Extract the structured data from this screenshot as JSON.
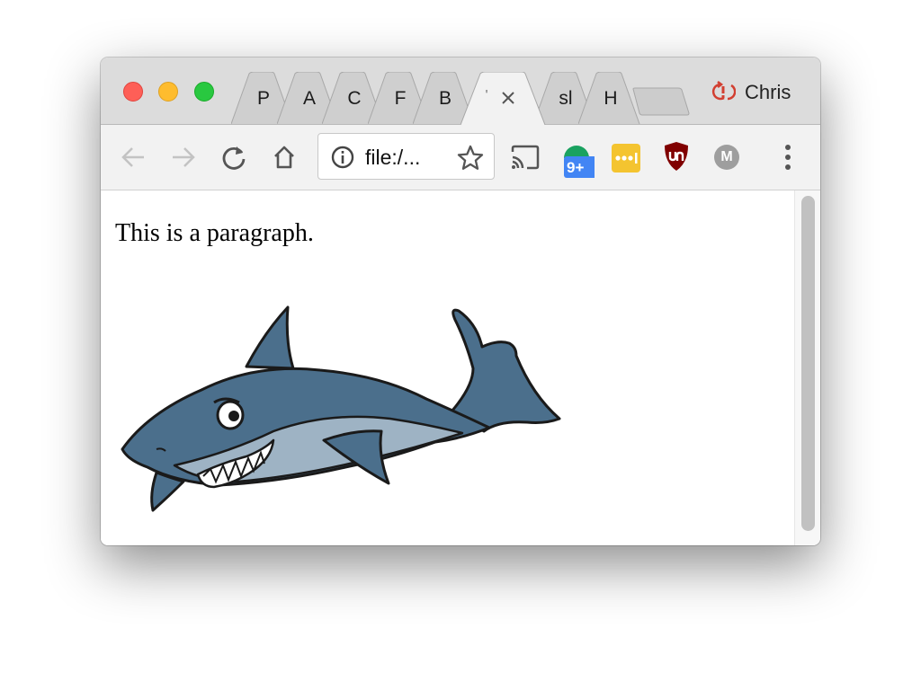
{
  "browser": {
    "tabs": [
      {
        "label": "P",
        "active": false
      },
      {
        "label": "A",
        "active": false
      },
      {
        "label": "C",
        "active": false
      },
      {
        "label": "F",
        "active": false
      },
      {
        "label": "B",
        "active": false
      },
      {
        "label": "'",
        "active": true
      },
      {
        "label": "sl",
        "active": false
      },
      {
        "label": "H",
        "active": false
      }
    ],
    "profile": {
      "name": "Chris",
      "icon": "sync-error-icon",
      "accent": "#d23f31"
    },
    "omnibox": {
      "text": "file:/...",
      "icon": "info-icon"
    },
    "extensions": [
      {
        "name": "calendar-extension",
        "badge": "9+",
        "color": "#1aa260",
        "badge_color": "#4285f4"
      },
      {
        "name": "lastpass-extension",
        "color": "#f4c430"
      },
      {
        "name": "ublock-extension",
        "color": "#800000"
      },
      {
        "name": "account-extension",
        "letter": "M",
        "color": "#9e9e9e"
      }
    ]
  },
  "page": {
    "paragraph": "This is a paragraph.",
    "image": "shark-cartoon"
  },
  "colors": {
    "shark_body": "#4b6f8c",
    "shark_belly": "#9eb3c4",
    "tab_bar": "#dcdcdc",
    "toolbar": "#f2f2f2"
  }
}
